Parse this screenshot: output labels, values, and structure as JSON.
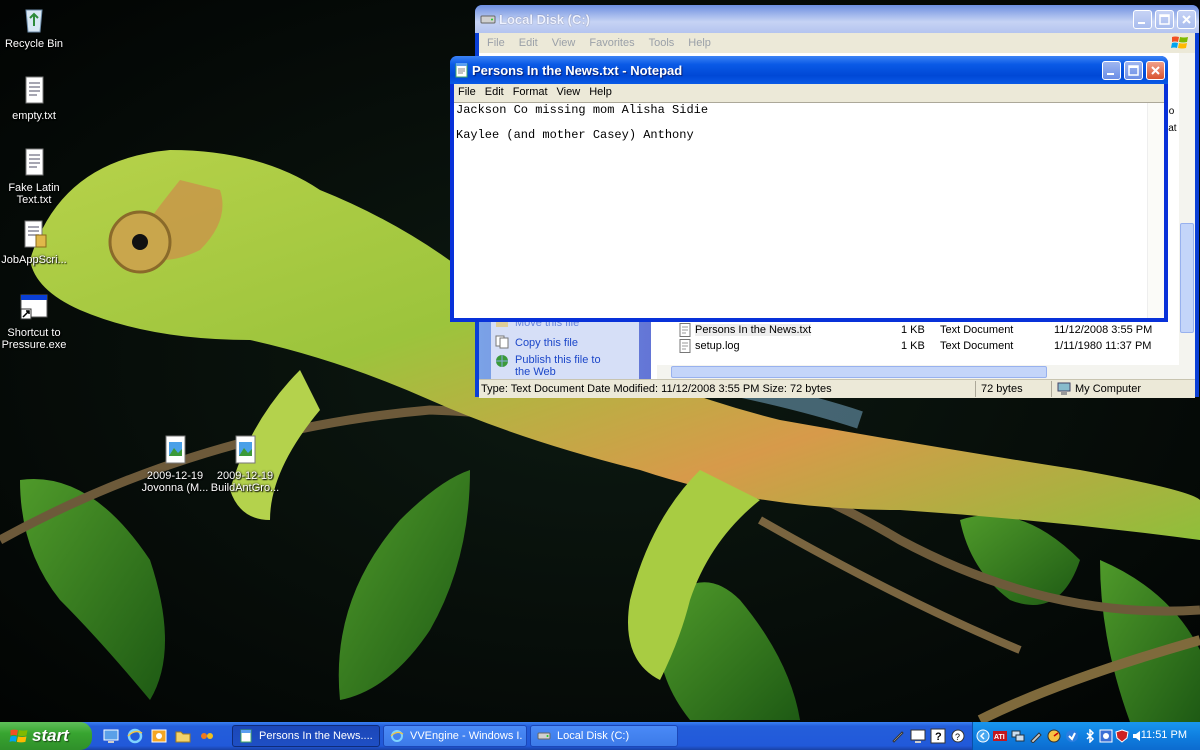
{
  "desktop": {
    "icons": [
      {
        "label": "Recycle Bin",
        "icon": "recycle-bin-icon"
      },
      {
        "label": "empty.txt",
        "icon": "text-file-icon"
      },
      {
        "label": "Fake Latin Text.txt",
        "icon": "text-file-icon"
      },
      {
        "label": "JobAppScri...",
        "icon": "script-file-icon"
      },
      {
        "label": "Shortcut to Pressure.exe",
        "icon": "shortcut-icon"
      },
      {
        "label": "2009-12-19 Jovonna (M...",
        "icon": "image-file-icon"
      },
      {
        "label": "2009-12-19 BuildAntGro...",
        "icon": "image-file-icon"
      }
    ]
  },
  "explorer": {
    "title": "Local Disk (C:)",
    "menu": [
      "File",
      "Edit",
      "View",
      "Favorites",
      "Tools",
      "Help"
    ],
    "tasks": [
      "Move this file",
      "Copy this file",
      "Publish this file to the Web"
    ],
    "files": [
      {
        "name": "Persons In the News.txt",
        "size": "1 KB",
        "type": "Text Document",
        "modified": "11/12/2008 3:55 PM"
      },
      {
        "name": "setup.log",
        "size": "1 KB",
        "type": "Text Document",
        "modified": "1/11/1980 11:37 PM"
      }
    ],
    "column_fragments": [
      "Go",
      "Dat"
    ],
    "status": {
      "info": "Type: Text Document Date Modified: 11/12/2008 3:55 PM Size: 72 bytes",
      "size": "72 bytes",
      "zone": "My Computer"
    }
  },
  "notepad": {
    "title": "Persons In the News.txt - Notepad",
    "menu": [
      "File",
      "Edit",
      "Format",
      "View",
      "Help"
    ],
    "lines": [
      "Jackson Co missing mom Alisha Sidie",
      "Kaylee (and mother Casey) Anthony"
    ]
  },
  "taskbar": {
    "start_label": "start",
    "quick_launch": [
      "show-desktop-icon",
      "internet-explorer-icon",
      "outlook-icon",
      "folder-icon",
      "media-player-icon"
    ],
    "buttons": [
      {
        "label": "Persons In the News....",
        "active": true
      },
      {
        "label": "VVEngine - Windows I...",
        "active": false
      },
      {
        "label": "Local Disk (C:)",
        "active": false
      }
    ],
    "clock": "11:51 PM"
  },
  "colors": {
    "xp_blue": "#0831d9",
    "start_green": "#38a530",
    "link_blue": "#1c47c9"
  }
}
